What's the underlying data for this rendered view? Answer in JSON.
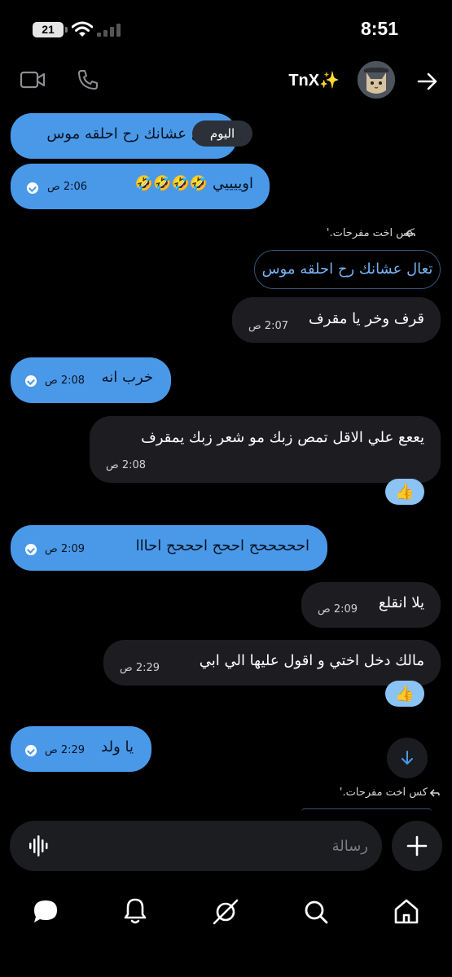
{
  "status_bar": {
    "time": "8:51",
    "battery": "21"
  },
  "header": {
    "contact_name": "TnX✨"
  },
  "date_divider": "اليوم",
  "messages": [
    {
      "text": "تعال عشانك رح احلقه موس",
      "time": ""
    },
    {
      "text": "اوييييي 🤣🤣🤣🤣",
      "time": "2:06 ص"
    },
    {
      "reply_to": "كس اخت مفرحات.'",
      "quote": "تعال عشانك رح احلقه موس",
      "text": "قرف وخر يا مقرف",
      "time": "2:07 ص"
    },
    {
      "text": "خرب انه",
      "time": "2:08 ص"
    },
    {
      "text": "يععع علي الاقل تمص زبك مو شعر زبك يمقرف",
      "time": "2:08 ص",
      "reaction": "👍"
    },
    {
      "text": "احححححح اححح احححح احااا",
      "time": "2:09 ص"
    },
    {
      "text": "يلا انقلع",
      "time": "2:09 ص"
    },
    {
      "text": "مالك دخل اختي و اقول عليها الي ابي",
      "time": "2:29 ص",
      "reaction": "👍"
    },
    {
      "text": "يا ولد",
      "time": "2:29 ص"
    },
    {
      "reply_to": "كس اخت مفرحات.'"
    }
  ],
  "composer": {
    "placeholder": "رسالة"
  },
  "colors": {
    "accent": "#4a99e9",
    "incoming_bubble": "#1d1d21",
    "background": "#000000"
  }
}
